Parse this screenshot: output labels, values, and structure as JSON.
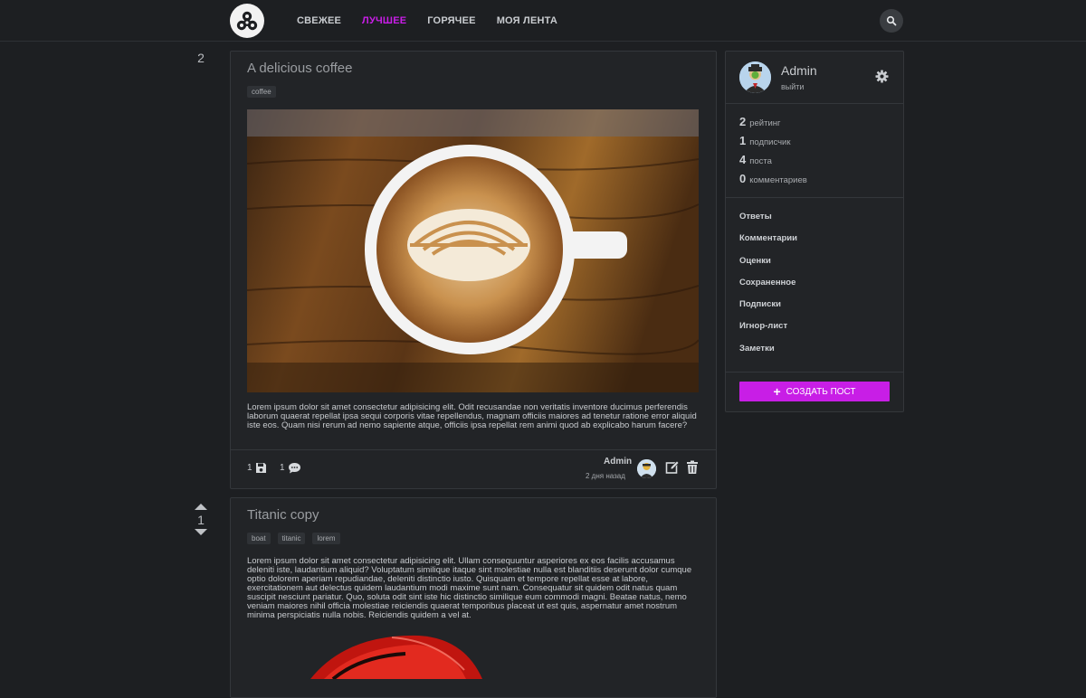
{
  "nav": {
    "items": [
      {
        "label": "СВЕЖЕЕ",
        "active": false
      },
      {
        "label": "ЛУЧШЕЕ",
        "active": true
      },
      {
        "label": "ГОРЯЧЕЕ",
        "active": false
      },
      {
        "label": "МОЯ ЛЕНТА",
        "active": false
      }
    ],
    "accent_color": "#c81ee6"
  },
  "posts": [
    {
      "rating": "2",
      "title": "A delicious coffee",
      "tags": [
        "coffee"
      ],
      "text": "Lorem ipsum dolor sit amet consectetur adipisicing elit. Odit recusandae non veritatis inventore ducimus perferendis laborum quaerat repellat ipsa sequi corporis vitae repellendus, magnam officiis maiores ad tenetur ratione error aliquid iste eos. Quam nisi rerum ad nemo sapiente atque, officiis ipsa repellat rem animi quod ab explicabo harum facere?",
      "saves": "1",
      "comments": "1",
      "author": "Admin",
      "time": "2 дня назад"
    },
    {
      "rating": "1",
      "title": "Titanic copy",
      "tags": [
        "boat",
        "titanic",
        "lorem"
      ],
      "text": "Lorem ipsum dolor sit amet consectetur adipisicing elit. Ullam consequuntur asperiores ex eos facilis accusamus deleniti iste, laudantium aliquid? Voluptatum similique itaque sint molestiae nulla est blanditiis deserunt dolor cumque optio dolorem aperiam repudiandae, deleniti distinctio iusto. Quisquam et tempore repellat esse at labore, exercitationem aut delectus quidem laudantium modi maxime sunt nam. Consequatur sit quidem odit natus quam suscipit nesciunt pariatur. Quo, soluta odit sint iste hic distinctio similique eum commodi magni. Beatae natus, nemo veniam maiores nihil officia molestiae reiciendis quaerat temporibus placeat ut est quis, aspernatur amet nostrum minima perspiciatis nulla nobis. Reiciendis quidem a vel at."
    }
  ],
  "sidebar": {
    "user_name": "Admin",
    "logout_label": "выйти",
    "stats": [
      {
        "value": "2",
        "label": "рейтинг"
      },
      {
        "value": "1",
        "label": "подписчик"
      },
      {
        "value": "4",
        "label": "поста"
      },
      {
        "value": "0",
        "label": "комментариев"
      }
    ],
    "links": [
      "Ответы",
      "Комментарии",
      "Оценки",
      "Сохраненное",
      "Подписки",
      "Игнор-лист",
      "Заметки"
    ],
    "create_label": "СОЗДАТЬ ПОСТ"
  },
  "icons": {
    "logo": "fidget-spinner-logo",
    "search": "search-icon",
    "save": "floppy-disk-icon",
    "comment": "comment-bubble-icon",
    "edit": "edit-icon",
    "delete": "trash-icon",
    "settings": "gear-icon"
  }
}
